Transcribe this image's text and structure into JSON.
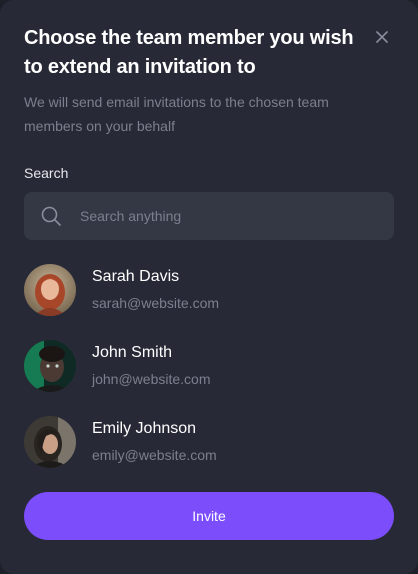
{
  "modal": {
    "title": "Choose the team member you wish to extend an invitation to",
    "subtitle": "We will send email invitations to the chosen team members on your behalf",
    "close_icon": "close-icon"
  },
  "search": {
    "label": "Search",
    "placeholder": "Search anything",
    "value": "",
    "icon": "search-icon"
  },
  "members": [
    {
      "name": "Sarah Davis",
      "email": "sarah@website.com"
    },
    {
      "name": "John Smith",
      "email": "john@website.com"
    },
    {
      "name": "Emily Johnson",
      "email": "emily@website.com"
    }
  ],
  "actions": {
    "invite_label": "Invite"
  },
  "colors": {
    "background": "#272a36",
    "accent": "#7b4dfb",
    "muted_text": "#7c7f8d",
    "input_background": "#343845"
  }
}
